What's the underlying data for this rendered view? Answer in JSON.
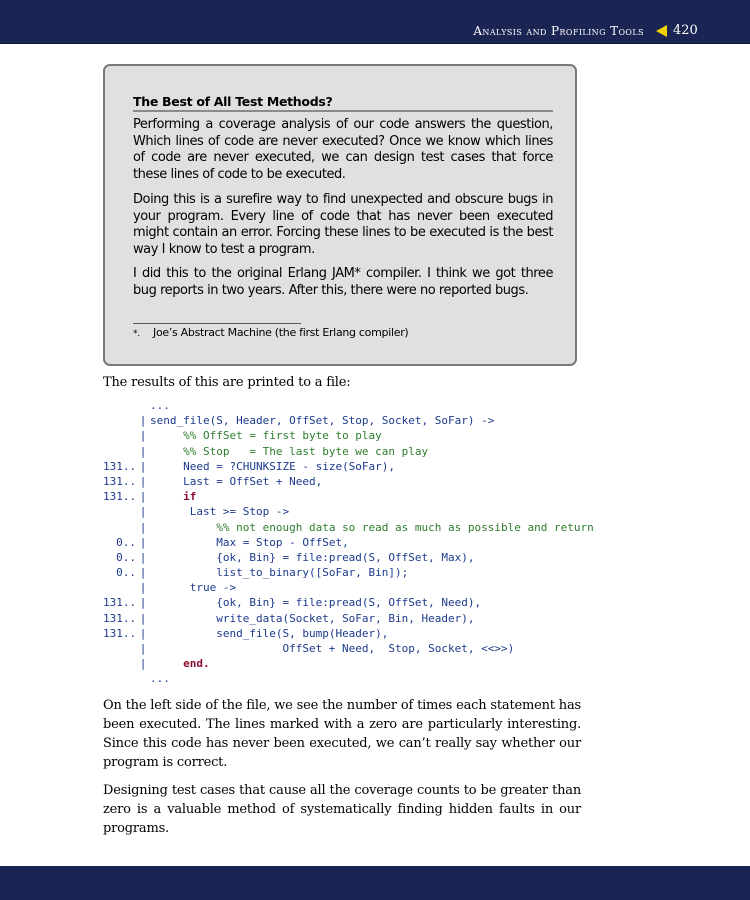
{
  "header": {
    "section": "Analysis and Profiling Tools",
    "page": "420"
  },
  "sidebar": {
    "title": "The Best of All Test Methods?",
    "paragraphs": [
      "Performing a coverage analysis of our code answers the question, Which lines of code are never executed? Once we know which lines of code are never executed, we can design test cases that force these lines of code to be executed.",
      "Doing this is a surefire way to find unexpected and obscure bugs in your program. Every line of code that has never been executed might contain an error. Forcing these lines to be executed is the best way I know to test a program.",
      "I did this to the original Erlang JAM* compiler. I think we got three bug reports in two years. After this, there were no reported bugs."
    ],
    "footnote_mark": "*.",
    "footnote": "Joe’s Abstract Machine (the first Erlang compiler)"
  },
  "intro": "The results of this are printed to a file:",
  "code": [
    {
      "count": "",
      "bar": "",
      "indent": "",
      "text": "...",
      "kind": "plain"
    },
    {
      "count": "",
      "bar": "|",
      "indent": "",
      "text": "send_file(S, Header, OffSet, Stop, Socket, SoFar) ->",
      "kind": "plain"
    },
    {
      "count": "",
      "bar": "|",
      "indent": "     ",
      "text": "%% OffSet = first byte to play",
      "kind": "comment"
    },
    {
      "count": "",
      "bar": "|",
      "indent": "     ",
      "text": "%% Stop   = The last byte we can play",
      "kind": "comment"
    },
    {
      "count": "131..",
      "bar": "|",
      "indent": "     ",
      "text": "Need = ?CHUNKSIZE - size(SoFar),",
      "kind": "plain"
    },
    {
      "count": "131..",
      "bar": "|",
      "indent": "     ",
      "text": "Last = OffSet + Need,",
      "kind": "plain"
    },
    {
      "count": "131..",
      "bar": "|",
      "indent": "     ",
      "text": "if",
      "kind": "keyword"
    },
    {
      "count": "",
      "bar": "|",
      "indent": "      ",
      "text": "Last >= Stop ->",
      "kind": "plain"
    },
    {
      "count": "",
      "bar": "|",
      "indent": "          ",
      "text": "%% not enough data so read as much as possible and return",
      "kind": "comment"
    },
    {
      "count": "0..",
      "bar": "|",
      "indent": "          ",
      "text": "Max = Stop - OffSet,",
      "kind": "plain"
    },
    {
      "count": "0..",
      "bar": "|",
      "indent": "          ",
      "text": "{ok, Bin} = file:pread(S, OffSet, Max),",
      "kind": "plain"
    },
    {
      "count": "0..",
      "bar": "|",
      "indent": "          ",
      "text": "list_to_binary([SoFar, Bin]);",
      "kind": "plain"
    },
    {
      "count": "",
      "bar": "|",
      "indent": "      ",
      "text": "true ->",
      "kind": "plain"
    },
    {
      "count": "131..",
      "bar": "|",
      "indent": "          ",
      "text": "{ok, Bin} = file:pread(S, OffSet, Need),",
      "kind": "plain"
    },
    {
      "count": "131..",
      "bar": "|",
      "indent": "          ",
      "text": "write_data(Socket, SoFar, Bin, Header),",
      "kind": "plain"
    },
    {
      "count": "131..",
      "bar": "|",
      "indent": "          ",
      "text": "send_file(S, bump(Header),",
      "kind": "plain"
    },
    {
      "count": "",
      "bar": "|",
      "indent": "                    ",
      "text": "OffSet + Need,  Stop, Socket, <<>>)",
      "kind": "plain"
    },
    {
      "count": "",
      "bar": "|",
      "indent": "     ",
      "text": "end.",
      "kind": "keyword"
    },
    {
      "count": "",
      "bar": "",
      "indent": "",
      "text": "...",
      "kind": "plain"
    }
  ],
  "after_paragraphs": [
    "On the left side of the file, we see the number of times each statement has been executed. The lines marked with a zero are particularly interesting. Since this code has never been executed, we can’t really say whether our program is correct.",
    "Designing test cases that cause all the coverage counts to be greater than zero is a valuable method of systematically finding hidden faults in our programs."
  ],
  "colors": {
    "header_bar": "#1b2553",
    "header_arrow": "#f2d200",
    "sidebar_bg": "#e0e0e0",
    "code_text": "#1c3a8c",
    "code_comment": "#2e7d2e",
    "code_keyword": "#8a0e2e"
  }
}
